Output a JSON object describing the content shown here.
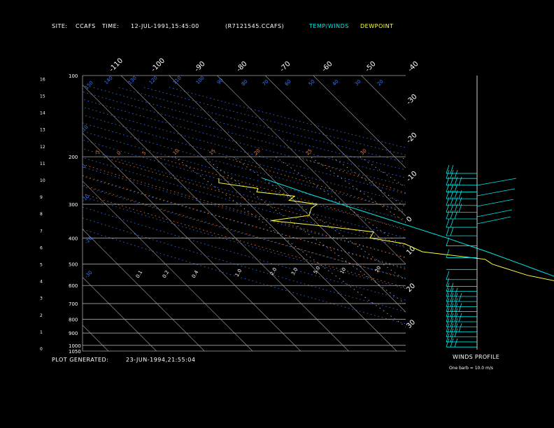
{
  "header": {
    "site_label": "SITE:",
    "site": "CCAFS",
    "time_label": "TIME:",
    "time": "12-JUL-1991,15:45:00",
    "file": "(R7121545.CCAFS)",
    "legend_temp": "TEMP/WINDS",
    "legend_dew": "DEWPOINT"
  },
  "footer": {
    "plot_label": "PLOT GENERATED:",
    "plot_date": "23-JUN-1994,21:55:04"
  },
  "winds_panel": {
    "title": "WINDS PROFILE",
    "note": "One barb = 10.0 m/s"
  },
  "colors": {
    "temp": "#00e8e8",
    "dew": "#ffff40",
    "isobar": "#a8a8a8",
    "isotherm": "#a8a8a8",
    "dry_adiabat": "#3a78ff",
    "moist_adiabat": "#ff7a2e",
    "mixing_ratio": "#ffffff",
    "axis_label": "#ffffff"
  },
  "chart_data": {
    "type": "line",
    "title": "",
    "xlabel": "",
    "ylabel": "",
    "pressure_levels_hpa": [
      "100",
      "200",
      "300",
      "400",
      "500",
      "600",
      "700",
      "800",
      "900",
      "1000",
      "1050"
    ],
    "height_km_ticks": [
      "0",
      "1",
      "2",
      "3",
      "4",
      "5",
      "6",
      "7",
      "8",
      "9",
      "10",
      "11",
      "12",
      "13",
      "14",
      "15",
      "16"
    ],
    "isotherm_labels_top": [
      "-110",
      "-100",
      "-90",
      "-80",
      "-70",
      "-60",
      "-50",
      "-40"
    ],
    "isotherm_labels_right": [
      "-30",
      "-20",
      "-10",
      "0",
      "10",
      "20",
      "30"
    ],
    "dry_adiabat_labels": [
      "150",
      "140",
      "130",
      "120",
      "110",
      "100",
      "90",
      "80",
      "70",
      "60",
      "50",
      "40",
      "30",
      "20",
      "10",
      "0",
      "-10",
      "-20",
      "-30"
    ],
    "moist_adiabat_labels": [
      "-5",
      "0",
      "5",
      "10",
      "15",
      "20",
      "25",
      "30"
    ],
    "mixing_ratio_labels": [
      "0.1",
      "0.2",
      "0.4",
      "1.0",
      "2.0",
      "3.0",
      "5.0",
      "10",
      "20"
    ],
    "series": [
      {
        "name": "TEMP/WINDS",
        "color": "#00e8e8",
        "points": [
          {
            "p": 1040,
            "t": 30.0
          },
          {
            "p": 1020,
            "t": 27.0
          },
          {
            "p": 1000,
            "t": 25.0
          },
          {
            "p": 950,
            "t": 22.0
          },
          {
            "p": 900,
            "t": 18.0
          },
          {
            "p": 850,
            "t": 15.2
          },
          {
            "p": 800,
            "t": 12.5
          },
          {
            "p": 750,
            "t": 9.5
          },
          {
            "p": 700,
            "t": 7.5
          },
          {
            "p": 650,
            "t": 4.0
          },
          {
            "p": 600,
            "t": 1.5
          },
          {
            "p": 550,
            "t": -2.0
          },
          {
            "p": 500,
            "t": -6.0
          },
          {
            "p": 450,
            "t": -10.5
          },
          {
            "p": 400,
            "t": -16.0
          },
          {
            "p": 350,
            "t": -23.0
          },
          {
            "p": 300,
            "t": -31.0
          },
          {
            "p": 275,
            "t": -35.5
          },
          {
            "p": 250,
            "t": -40.0
          },
          {
            "p": 240,
            "t": -42.0
          }
        ]
      },
      {
        "name": "DEWPOINT",
        "color": "#ffff40",
        "points": [
          {
            "p": 1040,
            "t": 23.0
          },
          {
            "p": 1020,
            "t": 22.0
          },
          {
            "p": 1000,
            "t": 21.5
          },
          {
            "p": 950,
            "t": 20.0
          },
          {
            "p": 900,
            "t": 17.5
          },
          {
            "p": 850,
            "t": 15.0
          },
          {
            "p": 800,
            "t": 11.0
          },
          {
            "p": 750,
            "t": 6.0
          },
          {
            "p": 700,
            "t": 3.0
          },
          {
            "p": 650,
            "t": 0.0
          },
          {
            "p": 600,
            "t": -3.5
          },
          {
            "p": 580,
            "t": -2.0
          },
          {
            "p": 550,
            "t": -7.0
          },
          {
            "p": 500,
            "t": -12.0
          },
          {
            "p": 480,
            "t": -12.5
          },
          {
            "p": 450,
            "t": -24.0
          },
          {
            "p": 420,
            "t": -26.0
          },
          {
            "p": 400,
            "t": -32.0
          },
          {
            "p": 380,
            "t": -30.0
          },
          {
            "p": 360,
            "t": -40.0
          },
          {
            "p": 345,
            "t": -49.0
          },
          {
            "p": 330,
            "t": -40.0
          },
          {
            "p": 310,
            "t": -38.0
          },
          {
            "p": 300,
            "t": -36.0
          },
          {
            "p": 290,
            "t": -41.0
          },
          {
            "p": 280,
            "t": -39.0
          },
          {
            "p": 270,
            "t": -46.0
          },
          {
            "p": 262,
            "t": -45.0
          },
          {
            "p": 250,
            "t": -52.0
          },
          {
            "p": 240,
            "t": -51.0
          }
        ]
      }
    ],
    "wind_profile_km": [
      {
        "h": 0.2,
        "n": 3
      },
      {
        "h": 0.5,
        "n": 2
      },
      {
        "h": 0.8,
        "n": 3
      },
      {
        "h": 1.1,
        "n": 4
      },
      {
        "h": 1.4,
        "n": 3
      },
      {
        "h": 1.7,
        "n": 4
      },
      {
        "h": 2.0,
        "n": 3
      },
      {
        "h": 2.3,
        "n": 4
      },
      {
        "h": 2.6,
        "n": 3
      },
      {
        "h": 2.9,
        "n": 4
      },
      {
        "h": 3.2,
        "n": 3
      },
      {
        "h": 3.5,
        "n": 2
      },
      {
        "h": 3.8,
        "n": 1
      },
      {
        "h": 4.2,
        "n": 1
      },
      {
        "h": 4.8,
        "n": 0
      },
      {
        "h": 5.5,
        "n": 1
      },
      {
        "h": 6.2,
        "n": 1
      },
      {
        "h": 6.8,
        "n": 2
      },
      {
        "h": 7.3,
        "n": 2
      },
      {
        "h": 7.8,
        "n": 3
      },
      {
        "h": 8.2,
        "n": 4
      },
      {
        "h": 8.6,
        "n": 4
      },
      {
        "h": 9.0,
        "n": 4
      },
      {
        "h": 9.4,
        "n": 3
      },
      {
        "h": 9.8,
        "n": 4
      },
      {
        "h": 10.2,
        "n": 3
      },
      {
        "h": 10.5,
        "n": 2
      }
    ]
  }
}
